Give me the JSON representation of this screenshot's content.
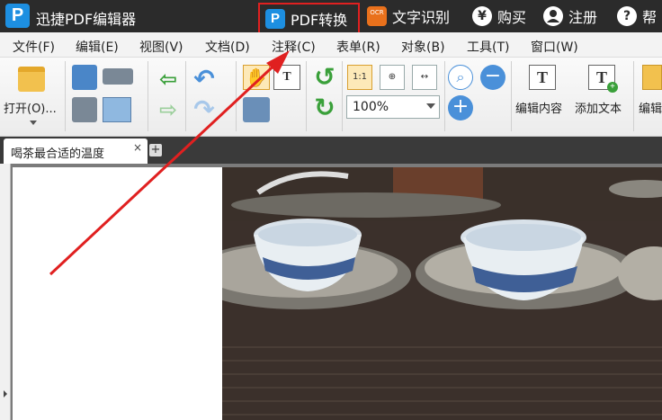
{
  "app": {
    "title": "迅捷PDF编辑器",
    "logo_letter": "P"
  },
  "titlebar": {
    "pdf_convert": "PDF转换",
    "ocr_badge": "OCR",
    "ocr": "文字识别",
    "buy": "购买",
    "buy_icon_char": "¥",
    "register": "注册",
    "help_icon_char": "?",
    "help": "帮"
  },
  "menu": [
    "文件(F)",
    "编辑(E)",
    "视图(V)",
    "文档(D)",
    "注释(C)",
    "表单(R)",
    "对象(B)",
    "工具(T)",
    "窗口(W)"
  ],
  "toolbar": {
    "open_label": "打开(O)...",
    "page_single_label": "1:1",
    "zoom_value": "100%",
    "edit_content_label": "编辑内容",
    "add_text_label": "添加文本",
    "edit_partial_label": "编辑"
  },
  "tabs": [
    {
      "label": "喝茶最合适的温度",
      "close": "×"
    }
  ],
  "tab_add": "+",
  "colors": {
    "titlebar": "#2b2b2b",
    "highlight": "#e02020",
    "accent": "#1d8fe1",
    "ocr": "#e9711c"
  },
  "icons": [
    "folder-icon",
    "save-icon",
    "print-icon",
    "email-icon",
    "prev-page-icon",
    "next-page-icon",
    "undo-icon",
    "redo-icon",
    "hand-tool-icon",
    "select-text-icon",
    "snapshot-icon",
    "rotate-icon",
    "actual-size-icon",
    "fit-page-icon",
    "fit-width-icon",
    "zoom-in-icon",
    "zoom-out-icon",
    "edit-content-icon",
    "add-text-icon"
  ]
}
